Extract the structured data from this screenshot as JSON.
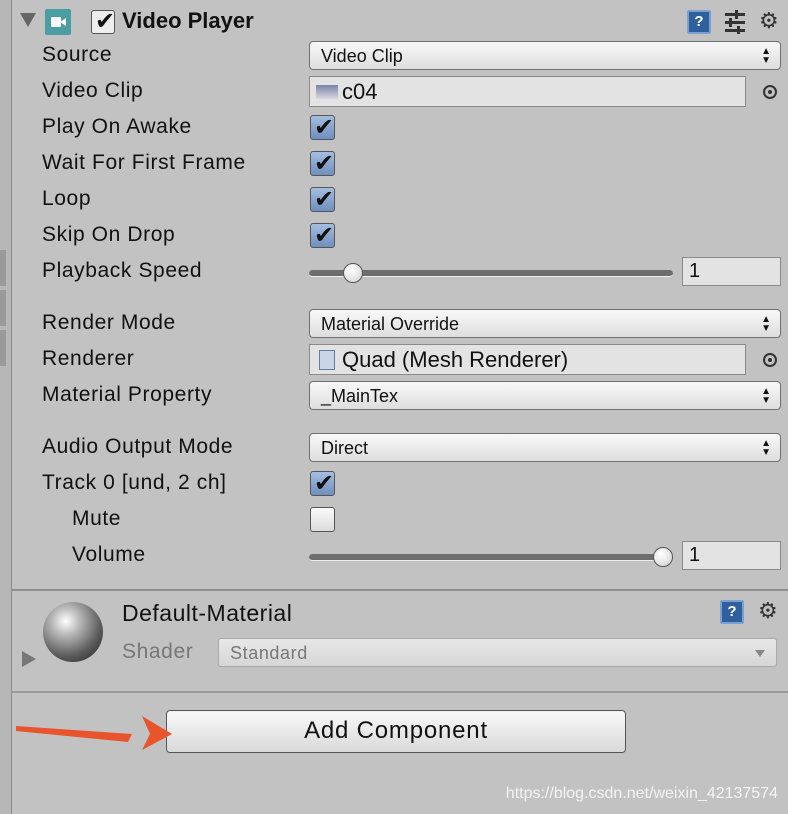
{
  "component": {
    "title": "Video Player",
    "enabled": true,
    "help_icon": "help-book-icon",
    "preset_icon": "presets-sliders-icon",
    "settings_icon": "gear-icon",
    "component_icon": "video-player-icon"
  },
  "fields": {
    "source": {
      "label": "Source",
      "value": "Video Clip"
    },
    "video_clip": {
      "label": "Video Clip",
      "value": "c04"
    },
    "play_on_awake": {
      "label": "Play On Awake",
      "checked": true
    },
    "wait_for_first_frame": {
      "label": "Wait For First Frame",
      "checked": true
    },
    "loop": {
      "label": "Loop",
      "checked": true
    },
    "skip_on_drop": {
      "label": "Skip On Drop",
      "checked": true
    },
    "playback_speed": {
      "label": "Playback Speed",
      "value": "1",
      "slider_fraction": 0.1
    },
    "render_mode": {
      "label": "Render Mode",
      "value": "Material Override"
    },
    "renderer": {
      "label": "Renderer",
      "value": "Quad (Mesh Renderer)"
    },
    "material_property": {
      "label": "Material Property",
      "value": "_MainTex"
    },
    "audio_output_mode": {
      "label": "Audio Output Mode",
      "value": "Direct"
    },
    "track0": {
      "label": "Track 0 [und, 2 ch]",
      "checked": true
    },
    "mute": {
      "label": "Mute",
      "checked": false
    },
    "volume": {
      "label": "Volume",
      "value": "1",
      "slider_fraction": 1.0
    }
  },
  "material": {
    "name": "Default-Material",
    "shader_label": "Shader",
    "shader_value": "Standard"
  },
  "add_component": {
    "label": "Add Component"
  },
  "annotation": {
    "arrow_color": "#e8542c"
  },
  "watermark": "https://blog.csdn.net/weixin_42137574"
}
